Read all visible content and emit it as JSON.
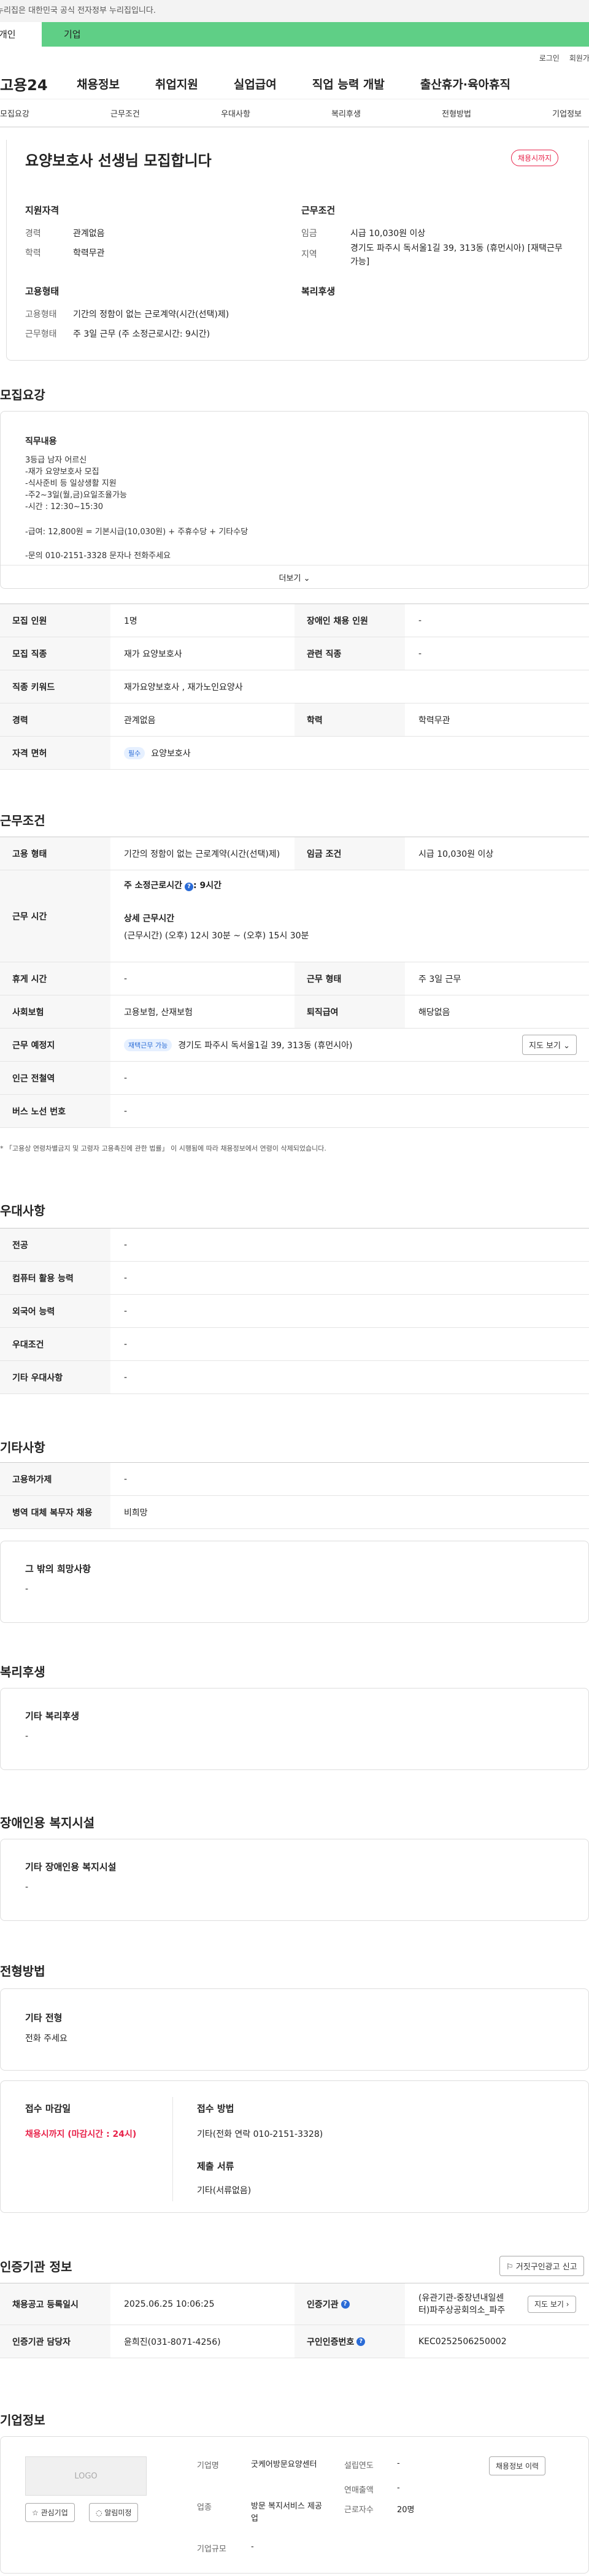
{
  "gov_banner": "이 누리집은 대한민국 공식 전자정부 누리집입니다.",
  "top_tabs": [
    "개인",
    "기업"
  ],
  "util": [
    "로그인",
    "회원가입"
  ],
  "brand": "고용24",
  "gnb": [
    "채용정보",
    "취업지원",
    "실업급여",
    "직업 능력 개발",
    "출산휴가·육아휴직"
  ],
  "snb": [
    "모집요강",
    "근무조건",
    "우대사항",
    "복리후생",
    "전형방법",
    "기업정보"
  ],
  "title": "요양보호사 선생님 모집합니다",
  "title_badge": "채용시까지",
  "summary": {
    "qual_head": "지원자격",
    "exp_l": "경력",
    "exp_v": "관계없음",
    "edu_l": "학력",
    "edu_v": "학력무관",
    "cond_head": "근무조건",
    "wage_l": "임금",
    "wage_v": "시급 10,030원 이상",
    "area_l": "지역",
    "area_v": "경기도 파주시 독서울1길 39, 313동 (휴먼시아) [재택근무 가능]",
    "emp_head": "고용형태",
    "emptype_l": "고용형태",
    "emptype_v": "기간의 정함이 없는 근로계약(시간(선택)제)",
    "workform_l": "근무형태",
    "workform_v": "주 3일 근무 (주 소정근로시간: 9시간)",
    "welfare_head": "복리후생"
  },
  "recruit": {
    "head": "모집요강",
    "duty_head": "직무내용",
    "duty_lines": [
      "3등급 남자 어르신",
      "-재가 요양보호사 모집",
      "-식사준비 등 일상생활 지원",
      "-주2~3일(월,금)요일조율가능",
      "-시간 : 12:30~15:30",
      "-급여: 12,800원 = 기본시급(10,030원) + 주휴수당 + 기타수당",
      "-문의 010-2151-3328 문자나 전화주세요"
    ],
    "more": "더보기",
    "rows": [
      {
        "a": "모집 인원",
        "b": "1명",
        "c": "장애인 채용 인원",
        "d": "-"
      },
      {
        "a": "모집 직종",
        "b": "재가 요양보호사",
        "c": "관련 직종",
        "d": "-"
      },
      {
        "a": "직종 키워드",
        "b": "재가요양보호사 , 재가노인요양사"
      },
      {
        "a": "경력",
        "b": "관계없음",
        "c": "학력",
        "d": "학력무관"
      },
      {
        "a": "자격 면허",
        "badge": "필수",
        "b": "요양보호사"
      }
    ]
  },
  "work": {
    "head": "근무조건",
    "emp_l": "고용 형태",
    "emp_v": "기간의 정함이 없는 근로계약(시간(선택)제)",
    "wage_l": "임금 조건",
    "wage_v": "시급 10,030원 이상",
    "time_l": "근무 시간",
    "weekly": "주 소정근로시간",
    "weekly_v": ": 9시간",
    "detail_head": "상세 근무시간",
    "detail_v": "(근무시간) (오후) 12시 30분 ~ (오후) 15시 30분",
    "rest_l": "휴게 시간",
    "rest_v": "-",
    "form_l": "근무 형태",
    "form_v": "주 3일 근무",
    "ins_l": "사회보험",
    "ins_v": "고용보험, 산재보험",
    "retire_l": "퇴직급여",
    "retire_v": "해당없음",
    "place_l": "근무 예정지",
    "place_badge": "재택근무 가능",
    "place_v": "경기도 파주시 독서울1길 39, 313동 (휴먼시아)",
    "map_btn": "지도 보기",
    "subway_l": "인근 전철역",
    "subway_v": "-",
    "bus_l": "버스 노선 번호",
    "bus_v": "-",
    "note": "* 「고용상 연령차별금지 및 고령자 고용촉진에 관한 법률」 이 시행됨에 따라 채용정보에서 연령이 삭제되었습니다."
  },
  "pref": {
    "head": "우대사항",
    "rows": [
      [
        "전공",
        "-"
      ],
      [
        "컴퓨터 활용 능력",
        "-"
      ],
      [
        "외국어 능력",
        "-"
      ],
      [
        "우대조건",
        "-"
      ],
      [
        "기타 우대사항",
        "-"
      ]
    ]
  },
  "etc": {
    "head": "기타사항",
    "rows": [
      [
        "고용허가제",
        "-"
      ],
      [
        "병역 대체 복무자 채용",
        "비희망"
      ]
    ],
    "hope_head": "그 밖의 희망사항",
    "hope_v": "-"
  },
  "welfare": {
    "head": "복리후생",
    "sub": "기타 복리후생",
    "v": "-"
  },
  "disabled": {
    "head": "장애인용 복지시설",
    "sub": "기타 장애인용 복지시설",
    "v": "-"
  },
  "screening": {
    "head": "전형방법",
    "sub": "기타 전형",
    "v": "전화 주세요",
    "deadline_l": "접수 마감일",
    "deadline_v": "채용시까지 (마감시간 : 24시)",
    "method_l": "접수 방법",
    "method_v": "기타(전화 연락 010-2151-3328)",
    "docs_l": "제출 서류",
    "docs_v": "기타(서류없음)"
  },
  "cert": {
    "head": "인증기관 정보",
    "report_btn": "거짓구인광고 신고",
    "reg_l": "채용공고 등록일시",
    "reg_v": "2025.06.25 10:06:25",
    "org_l": "인증기관",
    "org_v": "(유관기관-중장년내일센터)파주상공회의소_파주",
    "map_btn": "지도 보기",
    "mgr_l": "인증기관 담당자",
    "mgr_v": "윤희진(031-8071-4256)",
    "num_l": "구인인증번호",
    "num_v": "KEC0252506250002"
  },
  "company": {
    "head": "기업정보",
    "logo": "LOGO",
    "fav_btn": "관심기업",
    "alarm_btn": "알림미정",
    "name_l": "기업명",
    "name_v": "굿케어방문요양센터",
    "estab_l": "설립연도",
    "estab_v": "-",
    "ind_l": "업종",
    "ind_v": "방문 복지서비스 제공업",
    "sales_l": "연매출액",
    "sales_v": "-",
    "emp_l": "근로자수",
    "emp_v": "20명",
    "size_l": "기업규모",
    "size_v": "-",
    "jobs_btn": "채용정보 이력"
  },
  "colors": {
    "green": "#5fcf86",
    "red": "#e8234a",
    "blue": "#2a6bd6"
  }
}
